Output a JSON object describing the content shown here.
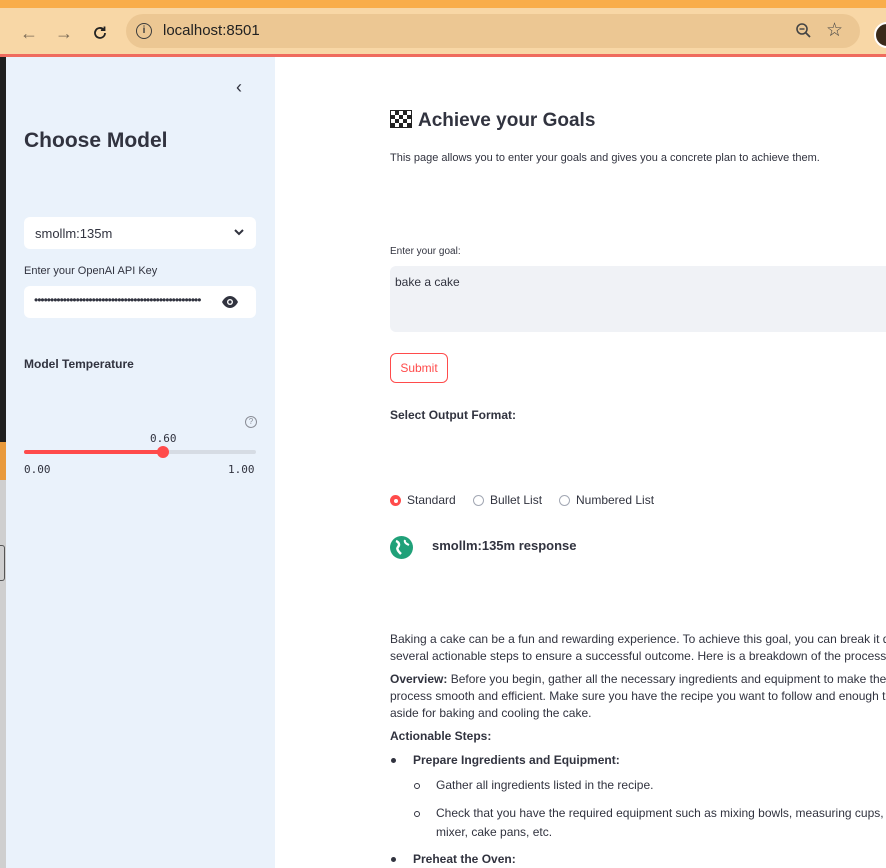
{
  "browser": {
    "url": "localhost:8501",
    "back_icon": "arrow-left-icon",
    "forward_icon": "arrow-right-icon",
    "reload_icon": "reload-icon"
  },
  "sidebar": {
    "title": "Choose Model",
    "model_select": {
      "value": "smollm:135m"
    },
    "api_key": {
      "label": "Enter your OpenAI API Key",
      "masked_value": "••••••••••••••••••••••••••••••••••••••••••••••••••••"
    },
    "temperature": {
      "label": "Model Temperature",
      "value_label": "0.60",
      "value": 0.6,
      "min": "0.00",
      "max": "1.00"
    }
  },
  "main": {
    "title": "Achieve your Goals",
    "description": "This page allows you to enter your goals and gives you a concrete plan to achieve them.",
    "goal": {
      "label": "Enter your goal:",
      "value": "bake a cake"
    },
    "submit_label": "Submit",
    "format": {
      "label": "Select Output Format:",
      "options": [
        "Standard",
        "Bullet List",
        "Numbered List"
      ],
      "selected": "Standard"
    },
    "response": {
      "title": "smollm:135m response",
      "intro_1": "Baking a cake can be a fun and rewarding experience. To achieve this goal, you can break it do",
      "intro_2": "several actionable steps to ensure a successful outcome. Here is a breakdown of the process:",
      "overview_label": "Overview:",
      "overview_1": " Before you begin, gather all the necessary ingredients and equipment to make the",
      "overview_2": "process smooth and efficient. Make sure you have the recipe you want to follow and enough ti",
      "overview_3": "aside for baking and cooling the cake.",
      "steps_label": "Actionable Steps:",
      "step1_title": "Prepare Ingredients and Equipment:",
      "step1_sub1": "Gather all ingredients listed in the recipe.",
      "step1_sub2_1": "Check that you have the required equipment such as mixing bowls, measuring cups, s",
      "step1_sub2_2": "mixer, cake pans, etc.",
      "step2_title": "Preheat the Oven:"
    }
  }
}
